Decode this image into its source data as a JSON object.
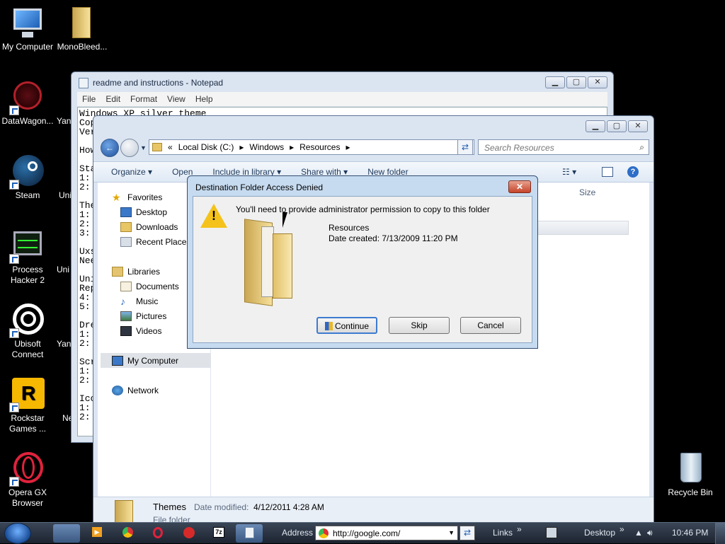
{
  "desktop_icons": [
    {
      "label": "My Computer",
      "icon": "computer-icon"
    },
    {
      "label": "MonoBleed...",
      "icon": "folder-icon"
    },
    {
      "label": "DataWagon...",
      "icon": "datawagon-icon"
    },
    {
      "label": "Steam",
      "icon": "steam-icon"
    },
    {
      "label": "Process Hacker 2",
      "icon": "process-hacker-icon"
    },
    {
      "label": "Ubisoft Connect",
      "icon": "ubisoft-icon"
    },
    {
      "label": "Rockstar Games ...",
      "icon": "rockstar-icon"
    },
    {
      "label": "Opera GX Browser",
      "icon": "opera-icon"
    },
    {
      "label": "Recycle Bin",
      "icon": "recycle-bin-icon"
    }
  ],
  "partial_icons": [
    "Yan",
    "Uni",
    "Uni",
    "Yan",
    "Ne"
  ],
  "notepad": {
    "title": "readme and instructions - Notepad",
    "menu": [
      "File",
      "Edit",
      "Format",
      "View",
      "Help"
    ],
    "lines": [
      "Windows XP silver theme",
      "Cop",
      "Ver",
      "",
      "How",
      "",
      "Sta",
      "1:",
      "2:",
      "",
      "The",
      "1:",
      "2:",
      "3:",
      "",
      "Uxs",
      "Nee",
      "",
      "Uni",
      "Rep",
      "4:",
      "5:",
      "",
      "Dre",
      "1:",
      "2:",
      "",
      "Scr",
      "1:",
      "2:",
      "",
      "Ico",
      "1:",
      "2:"
    ]
  },
  "explorer": {
    "breadcrumb": [
      "«",
      "Local Disk (C:)",
      "Windows",
      "Resources"
    ],
    "search_placeholder": "Search Resources",
    "commands": [
      "Organize ▾",
      "Open",
      "Include in library ▾",
      "Share with ▾",
      "New folder"
    ],
    "column_size": "Size",
    "nav": {
      "favorites": "Favorites",
      "favorite_items": [
        "Desktop",
        "Downloads",
        "Recent Places"
      ],
      "libraries": "Libraries",
      "library_items": [
        "Documents",
        "Music",
        "Pictures",
        "Videos"
      ],
      "my_computer": "My Computer",
      "network": "Network"
    },
    "status": {
      "name": "Themes",
      "modified_label": "Date modified:",
      "modified": "4/12/2011 4:28 AM",
      "type": "File folder"
    }
  },
  "dialog": {
    "title": "Destination Folder Access Denied",
    "message": "You'll need to provide administrator permission to copy to this folder",
    "folder_name": "Resources",
    "date_created": "Date created: 7/13/2009 11:20 PM",
    "buttons": {
      "continue": "Continue",
      "skip": "Skip",
      "cancel": "Cancel"
    },
    "close": "✕"
  },
  "taskbar": {
    "address_label": "Address",
    "address_value": "http://google.com/",
    "links_label": "Links",
    "desktop_label": "Desktop",
    "clock": "10:46 PM"
  },
  "colors": {
    "accent": "#1c5fb8",
    "dialog_frame": "#c6dbf0",
    "close_red": "#c6442a"
  }
}
